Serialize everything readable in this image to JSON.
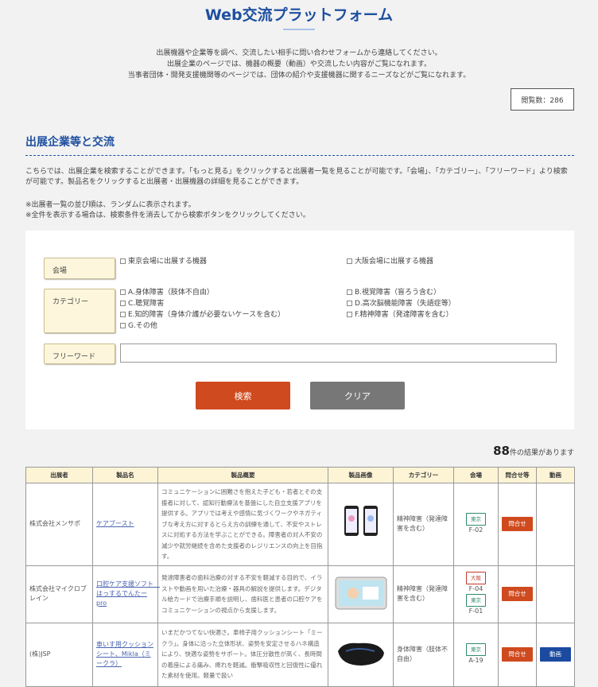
{
  "header": {
    "title": "Web交流プラットフォーム",
    "intro": [
      "出展機器や企業等を調べ、交流したい相手に問い合わせフォームから連絡してください。",
      "出展企業のページでは、機器の概要（動画）や交流したい内容がご覧になれます。",
      "当事者団体・開発支援機関等のページでは、団体の紹介や支援機器に関するニーズなどがご覧になれます。"
    ],
    "view_count": "閲覧数：286"
  },
  "section": {
    "title": "出展企業等と交流",
    "description": "こちらでは、出展企業を検索することができます。「もっと見る」をクリックすると出展者一覧を見ることが可能です。「会場」、「カテゴリー」、「フリーワード」より検索が可能です。製品名をクリックすると出展者・出展機器の詳細を見ることができます。",
    "notes": [
      "※出展者一覧の並び順は、ランダムに表示されます。",
      "※全件を表示する場合は、検索条件を消去してから検索ボタンをクリックしてください。"
    ]
  },
  "search": {
    "venue_label": "会場",
    "venues": [
      "東京会場に出展する機器",
      "大阪会場に出展する機器"
    ],
    "category_label": "カテゴリー",
    "categories": [
      "A.身体障害（肢体不自由）",
      "B.視覚障害（盲ろう含む）",
      "C.聴覚障害",
      "D.高次脳機能障害（失語症等）",
      "E.知的障害（身体介護が必要ないケースを含む）",
      "F.精神障害（発達障害を含む）",
      "G.その他"
    ],
    "freeword_label": "フリーワード",
    "freeword_value": "",
    "search_button": "検索",
    "clear_button": "クリア"
  },
  "results": {
    "count": "88",
    "suffix": "件の結果があります",
    "columns": [
      "出展者",
      "製品名",
      "製品概要",
      "製品画像",
      "カテゴリー",
      "会場",
      "問合せ等",
      "動画"
    ],
    "rows": [
      {
        "exhibitor": "株式会社メンサポ",
        "product": "ケアブースト",
        "summary": "コミュニケーションに困難さを抱えた子ども・若者とその支援者に対して、認知行動療法を基盤にした自立支援アプリを提供する。アプリでは考えや感情に気づくワークやネガティブな考え方に対するとらえ方の訓練を通して、不安やストレスに対処する方法を学ぶことができる。障害者の対人不安の減少や就労継続を含めた支援者のレジリエンスの向上を目指す。",
        "category": "精神障害（発達障害を含む）",
        "venues": [
          {
            "name": "東京",
            "booth": "F-02"
          }
        ],
        "inquiry": "問合せ",
        "video": ""
      },
      {
        "exhibitor": "株式会社マイクロブレイン",
        "product": "口腔ケア支援ソフト　はっするでんたーpro",
        "summary": "発達障害者の歯科治療の対する不安を軽減する目的で、イラストや動画を用いた治療・器具の解説を提供します。デジタル絵カードで治療手順を説明し、歯科医と患者の口腔ケアをコミュニケーションの視点から支援します。",
        "category": "精神障害（発達障害を含む）",
        "venues": [
          {
            "name": "大阪",
            "booth": "F-04"
          },
          {
            "name": "東京",
            "booth": "F-01"
          }
        ],
        "inquiry": "問合せ",
        "video": ""
      },
      {
        "exhibitor": "(株)JSP",
        "product": "車いす用クッションシート、Mikla（ミークラ）",
        "summary": "いまだかつてない快適さ。車椅子用クッションシート「ミークラ」。身体に沿った立体形状、姿勢を安定させるハネ構造により、快適な姿勢をサポート。体圧分散性が高く、長時間の着座による痛み、痺れを軽減。衝撃吸収性と回復性に優れた素材を使用。軽量で扱い",
        "category": "身体障害（肢体不自由）",
        "venues": [
          {
            "name": "東京",
            "booth": "A-19"
          }
        ],
        "inquiry": "問合せ",
        "video": "動画"
      }
    ]
  },
  "colors": {
    "brand": "#1e4fa0",
    "search": "#cf4a1e",
    "clear": "#777777",
    "video": "#1b4aa0"
  }
}
